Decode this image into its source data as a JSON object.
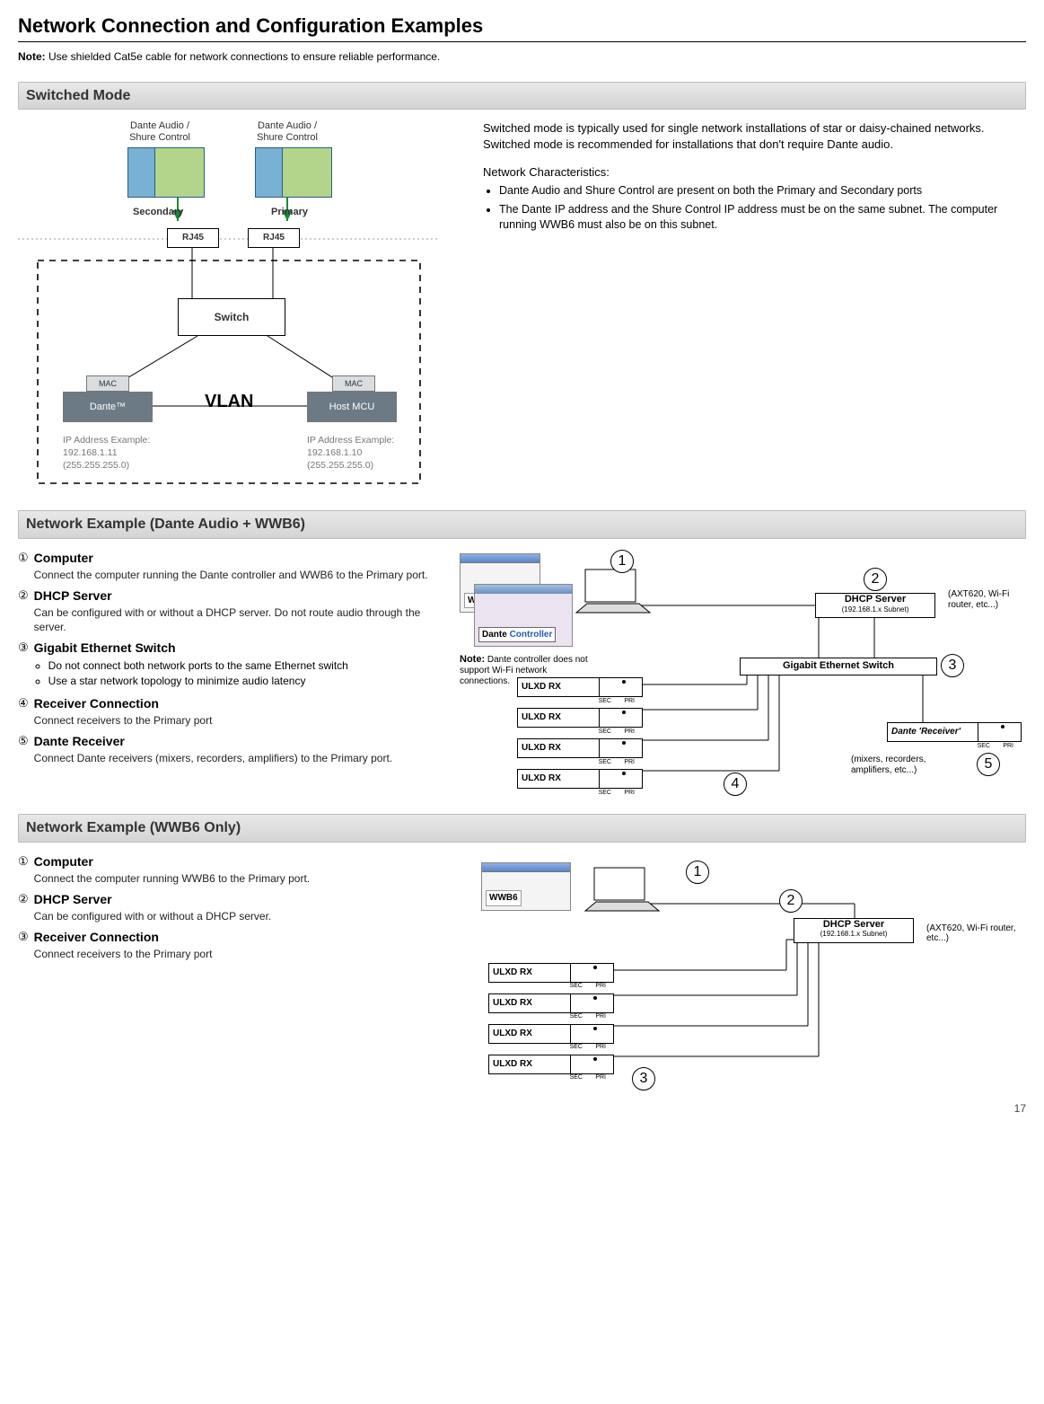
{
  "page_number": "17",
  "title": "Network Connection and Configuration Examples",
  "note": {
    "label": "Note:",
    "text": " Use shielded Cat5e cable for network connections to ensure reliable performance."
  },
  "switched": {
    "heading": "Switched Mode",
    "paragraph": "Switched mode is typically used for single network installations of star or daisy-chained networks. Switched mode is recommended for installations that don't require Dante audio.",
    "chars_title": "Network Characteristics:",
    "bullets": [
      "Dante Audio and Shure Control are present on both the Primary and Secondary ports",
      "The Dante IP address and the Shure Control IP address must be on the same subnet. The computer running WWB6 must also be on this subnet."
    ],
    "diag": {
      "top_l1": "Dante Audio /",
      "top_l2": "Shure Control",
      "secondary": "Secondary",
      "primary": "Primary",
      "rj45": "RJ45",
      "switch": "Switch",
      "vlan": "VLAN",
      "mac": "MAC",
      "dante": "Dante™",
      "host": "Host MCU",
      "ipex_title": "IP Address Example:",
      "ip1": "192.168.1.11",
      "ip2": "192.168.1.10",
      "mask": "(255.255.255.0)"
    }
  },
  "ex1": {
    "heading": "Network Example (Dante Audio + WWB6)",
    "items": [
      {
        "num": "①",
        "title": "Computer",
        "desc": "Connect the computer running the Dante controller and WWB6 to the Primary port."
      },
      {
        "num": "②",
        "title": "DHCP Server",
        "desc": "Can be configured with or without a DHCP server. Do not route audio through the server."
      },
      {
        "num": "③",
        "title": "Gigabit Ethernet Switch",
        "sub": [
          "Do not connect both network ports to the same Ethernet switch",
          "Use a star network topology to minimize audio latency"
        ]
      },
      {
        "num": "④",
        "title": "Receiver Connection",
        "desc": "Connect receivers to the Primary port"
      },
      {
        "num": "⑤",
        "title": "Dante Receiver",
        "desc": "Connect Dante receivers (mixers, recorders, amplifiers) to the Primary port."
      }
    ],
    "diag": {
      "wwb6": "WWB6",
      "dante_ctrl_a": "Dante ",
      "dante_ctrl_b": "Controller",
      "note_label": "Note:",
      "note_text": " Dante controller does not support Wi-Fi network connections.",
      "dhcp_t": "DHCP Server",
      "dhcp_s": "(192.168.1.x Subnet)",
      "dhcp_note": "(AXT620, Wi-Fi router, etc...)",
      "switch": "Gigabit Ethernet Switch",
      "rx": "ULXD RX",
      "sec": "SEC",
      "pri": "PRI",
      "dante_rx": "Dante 'Receiver'",
      "dante_rx_note": "(mixers, recorders, amplifiers, etc...)",
      "c1": "1",
      "c2": "2",
      "c3": "3",
      "c4": "4",
      "c5": "5"
    }
  },
  "ex2": {
    "heading": "Network Example (WWB6 Only)",
    "items": [
      {
        "num": "①",
        "title": "Computer",
        "desc": "Connect the computer running WWB6 to the Primary port."
      },
      {
        "num": "②",
        "title": "DHCP Server",
        "desc": "Can be configured with or without a DHCP server."
      },
      {
        "num": "③",
        "title": "Receiver Connection",
        "desc": "Connect receivers to the Primary port"
      }
    ],
    "diag": {
      "wwb6": "WWB6",
      "dhcp_t": "DHCP Server",
      "dhcp_s": "(192.168.1.x Subnet)",
      "dhcp_note": "(AXT620, Wi-Fi router, etc...)",
      "rx": "ULXD RX",
      "sec": "SEC",
      "pri": "PRI",
      "c1": "1",
      "c2": "2",
      "c3": "3"
    }
  }
}
